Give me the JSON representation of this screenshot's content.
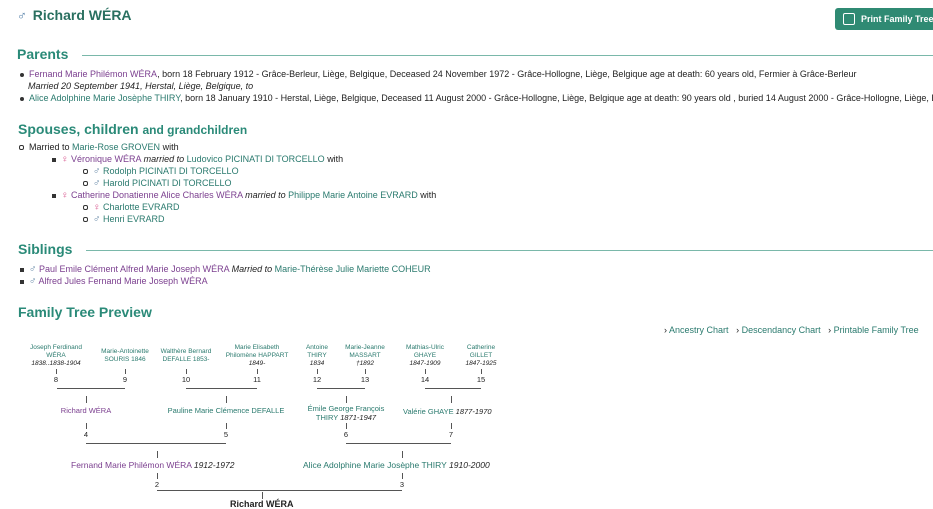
{
  "person": {
    "name": "Richard WÉRA",
    "symbol": "♂"
  },
  "print_button": "Print Family Tree",
  "parents": {
    "heading": "Parents",
    "father": {
      "name": "Fernand Marie Philémon WÉRA",
      "details": ", born 18 February 1912 - Grâce-Berleur, Liège, Belgique, Deceased 24 November 1972 - Grâce-Hollogne, Liège, Belgique age at death: 60 years old, Fermier à Grâce-Berleur",
      "marriage": "Married 20 September 1941, Herstal, Liège, Belgique, to"
    },
    "mother": {
      "name": "Alice Adolphine Marie Josèphe THIRY",
      "details": ", born 18 January 1910 - Herstal, Liège, Belgique, Deceased 11 August 2000 - Grâce-Hollogne, Liège, Belgique age at death: 90 years old , buried 14 August 2000 - Grâce-Hollogne, Liège, Belgique"
    }
  },
  "spouses": {
    "heading": "Spouses, children",
    "heading_small": "and grandchildren",
    "married_to": "Married to",
    "spouse": "Marie-Rose GROVEN",
    "with": "with",
    "children": [
      {
        "name": "Véronique WÉRA",
        "married_to": "married to",
        "spouse": "Ludovico PICINATI DI TORCELLO",
        "with": "with",
        "kids": [
          {
            "name": "Rodolph PICINATI DI TORCELLO"
          },
          {
            "name": "Harold PICINATI DI TORCELLO"
          }
        ]
      },
      {
        "name": "Catherine Donatienne Alice Charles WÉRA",
        "married_to": "married to",
        "spouse": "Philippe Marie Antoine EVRARD",
        "with": "with",
        "kids": [
          {
            "name": "Charlotte EVRARD"
          },
          {
            "name": "Henri EVRARD"
          }
        ]
      }
    ]
  },
  "siblings": {
    "heading": "Siblings",
    "items": [
      {
        "name": "Paul Emile Clément Alfred Marie Joseph WÉRA",
        "married_to": "Married to",
        "spouse": "Marie-Thérèse Julie Mariette COHEUR"
      },
      {
        "name": "Alfred Jules Fernand Marie Joseph WÉRA"
      }
    ]
  },
  "tree": {
    "heading": "Family Tree Preview",
    "links": [
      "Ancestry Chart",
      "Descendancy Chart",
      "Printable Family Tree"
    ],
    "gen4": [
      {
        "name1": "Joseph Ferdinand",
        "name2": "WÉRA",
        "dates": "1838..1838-1904",
        "num": "8"
      },
      {
        "name1": "Marie-Antoinette",
        "name2": "SOURIS 1846",
        "dates": "",
        "num": "9"
      },
      {
        "name1": "Walthère Bernard",
        "name2": "DEFALLE 1853-",
        "dates": "",
        "num": "10"
      },
      {
        "name1": "Marie Elisabeth",
        "name2": "Philomène HAPPART",
        "dates": "1849-",
        "num": "11"
      },
      {
        "name1": "Antoine",
        "name2": "THIRY",
        "dates": "1834",
        "num": "12"
      },
      {
        "name1": "Marie-Jeanne",
        "name2": "MASSART",
        "dates": "†1892",
        "num": "13"
      },
      {
        "name1": "Mathias-Ulric",
        "name2": "GHAYE",
        "dates": "1847-1909",
        "num": "14"
      },
      {
        "name1": "Catherine",
        "name2": "GILLET",
        "dates": "1847-1925",
        "num": "15"
      }
    ],
    "gen3": [
      {
        "name": "Richard WÉRA",
        "dates": "",
        "num": "4"
      },
      {
        "name": "Pauline Marie Clémence DEFALLE",
        "dates": "",
        "num": "5"
      },
      {
        "name": "Émile George François THIRY",
        "dates": "1871-1947",
        "num": "6"
      },
      {
        "name": "Valérie GHAYE",
        "dates": "1877-1970",
        "num": "7"
      }
    ],
    "gen2": [
      {
        "name": "Fernand Marie Philémon WÉRA",
        "dates": "1912-1972",
        "num": "2"
      },
      {
        "name": "Alice Adolphine Marie Josèphe THIRY",
        "dates": "1910-2000",
        "num": "3"
      }
    ],
    "root": "Richard WÉRA"
  }
}
